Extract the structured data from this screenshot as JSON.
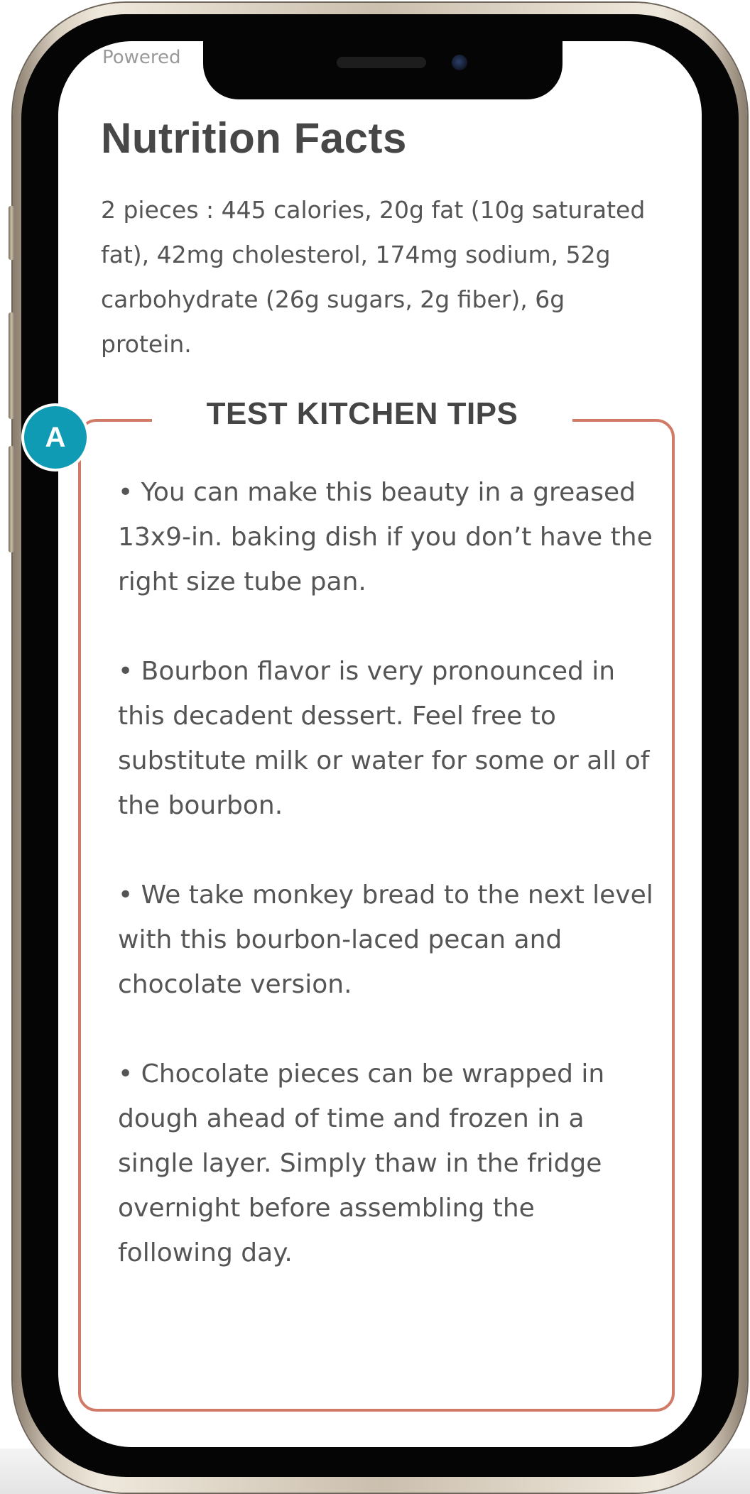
{
  "header": {
    "powered_text": "Powered"
  },
  "nutrition": {
    "title": "Nutrition Facts",
    "summary": "2 pieces : 445 calories, 20g fat (10g saturated fat), 42mg cholesterol, 174mg sodium, 52g carbohydrate (26g sugars, 2g fiber), 6g protein."
  },
  "tips": {
    "title": "TEST KITCHEN TIPS",
    "items": [
      "• You can make this beauty in a greased 13x9-in. baking dish if you don’t have the right size tube pan.",
      "• Bourbon flavor is very pronounced in this decadent dessert. Feel free to substitute milk or water for some or all of the bourbon.",
      "• We take monkey bread to the next level with this bourbon-laced pecan and chocolate version.",
      "• Chocolate pieces can be wrapped in dough ahead of time and frozen in a single layer. Simply thaw in the fridge overnight before assembling the following day."
    ]
  },
  "annotation": {
    "badge_label": "A",
    "badge_color": "#0f9bb3"
  },
  "colors": {
    "accent_border": "#d27a68",
    "text": "#555555",
    "heading": "#474747"
  }
}
